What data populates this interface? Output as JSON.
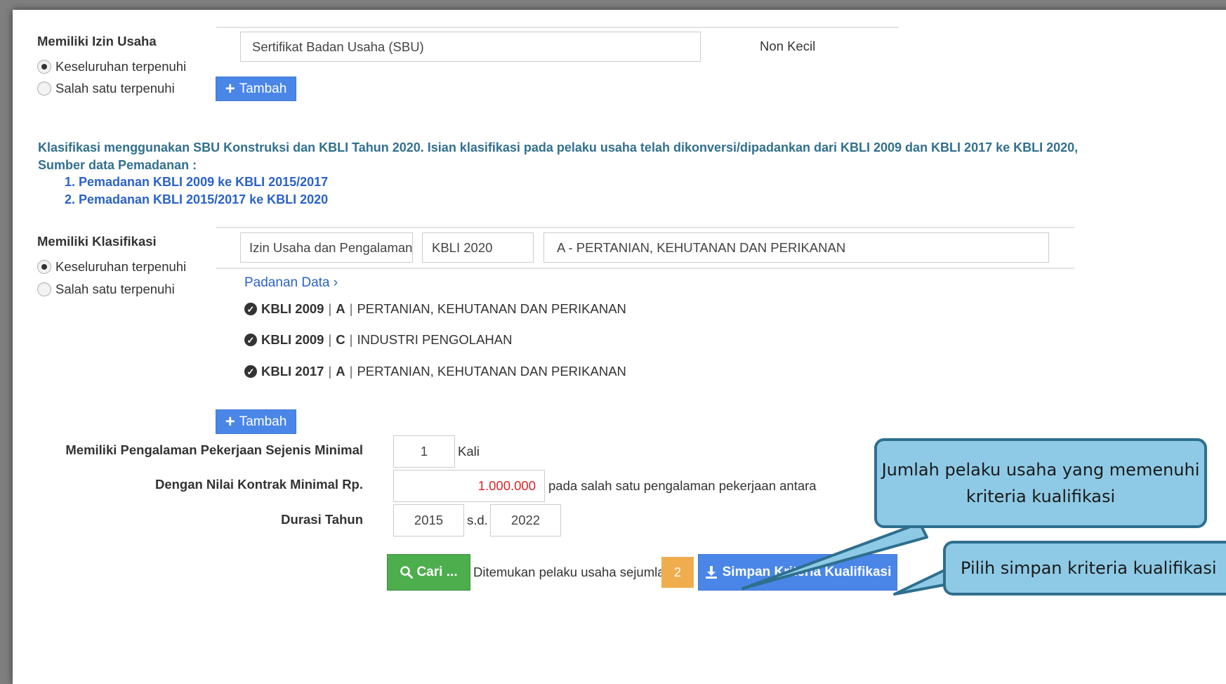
{
  "izin_usaha": {
    "label": "Memiliki Izin Usaha",
    "option_all": "Keseluruhan terpenuhi",
    "option_one": "Salah satu terpenuhi",
    "selected": "all",
    "name": "Sertifikat Badan Usaha (SBU)",
    "kualifikasi": "Non Kecil",
    "add_button": "Tambah"
  },
  "note": {
    "text": "Klasifikasi menggunakan SBU Konstruksi dan KBLI Tahun 2020. Isian klasifikasi pada pelaku usaha telah dikonversi/dipadankan dari KBLI 2009 dan KBLI 2017 ke KBLI 2020,",
    "source_label": "Sumber data Pemadanan :",
    "links": [
      "1. Pemadanan KBLI 2009 ke KBLI 2015/2017",
      "2. Pemadanan KBLI 2015/2017 ke KBLI 2020"
    ]
  },
  "klasifikasi": {
    "label": "Memiliki Klasifikasi",
    "option_all": "Keseluruhan terpenuhi",
    "option_one": "Salah satu terpenuhi",
    "selected": "all",
    "jenis": "Izin Usaha dan Pengalaman",
    "versi": "KBLI 2020",
    "kode": "A - PERTANIAN, KEHUTANAN DAN PERIKANAN",
    "padanan_link": "Padanan Data ›",
    "padanan": [
      {
        "versi": "KBLI 2009",
        "kode": "A",
        "nama": "PERTANIAN, KEHUTANAN DAN PERIKANAN"
      },
      {
        "versi": "KBLI 2009",
        "kode": "C",
        "nama": "INDUSTRI PENGOLAHAN"
      },
      {
        "versi": "KBLI 2017",
        "kode": "A",
        "nama": "PERTANIAN, KEHUTANAN DAN PERIKANAN"
      }
    ],
    "add_button": "Tambah"
  },
  "pengalaman": {
    "label": "Memiliki Pengalaman Pekerjaan Sejenis Minimal",
    "value": "1",
    "unit": "Kali",
    "nilai_label": "Dengan Nilai Kontrak Minimal Rp.",
    "nilai_value": "1.000.000",
    "nilai_suffix": "pada salah satu pengalaman pekerjaan antara",
    "durasi_label": "Durasi Tahun",
    "tahun_dari": "2015",
    "sd": "s.d.",
    "tahun_sampai": "2022"
  },
  "actions": {
    "cari": "Cari ...",
    "found_text": "Ditemukan pelaku usaha sejumlah:",
    "found_count": "2",
    "simpan": "Simpan Kriteria Kualifikasi"
  },
  "callouts": {
    "jumlah": "Jumlah pelaku usaha yang memenuhi kriteria kualifikasi",
    "simpan": "Pilih simpan kriteria kualifikasi"
  },
  "colors": {
    "primary": "#4a86e8",
    "success": "#4cae4c",
    "warning": "#f0ad4e",
    "note": "#31708f",
    "link": "#2a62c9",
    "callout_fill": "#8ecae6",
    "callout_border": "#2e6f8e",
    "value_red": "#d9262b"
  }
}
